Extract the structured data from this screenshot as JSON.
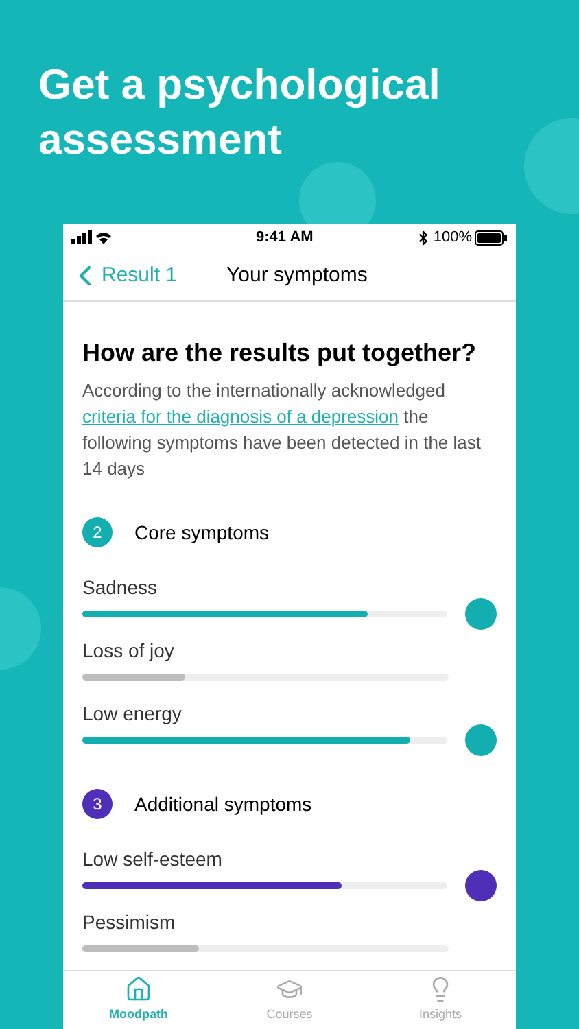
{
  "headline": "Get a psychological assessment",
  "status_bar": {
    "time": "9:41 AM",
    "battery": "100%"
  },
  "nav": {
    "back": "Result 1",
    "title": "Your symptoms"
  },
  "intro": {
    "heading": "How are the results put together?",
    "text_before": "According to the internationally acknowledged",
    "link": "criteria for the diagnosis of a depression",
    "text_after": "the following symptoms have been detected in the last 14 days"
  },
  "groups": [
    {
      "count": "2",
      "title": "Core symptoms",
      "color": "#12aeb0",
      "symptoms": [
        {
          "name": "Sadness",
          "level": 0.78,
          "flagged": true
        },
        {
          "name": "Loss of joy",
          "level": 0.28,
          "flagged": false
        },
        {
          "name": "Low energy",
          "level": 0.9,
          "flagged": true
        }
      ]
    },
    {
      "count": "3",
      "title": "Additional symptoms",
      "color": "#4f2fb8",
      "symptoms": [
        {
          "name": "Low self-esteem",
          "level": 0.71,
          "flagged": true
        },
        {
          "name": "Pessimism",
          "level": 0.32,
          "flagged": false
        }
      ]
    }
  ],
  "tab_bar": [
    {
      "label": "Moodpath",
      "selected": true
    },
    {
      "label": "Courses",
      "selected": false
    },
    {
      "label": "Insights",
      "selected": false
    }
  ]
}
